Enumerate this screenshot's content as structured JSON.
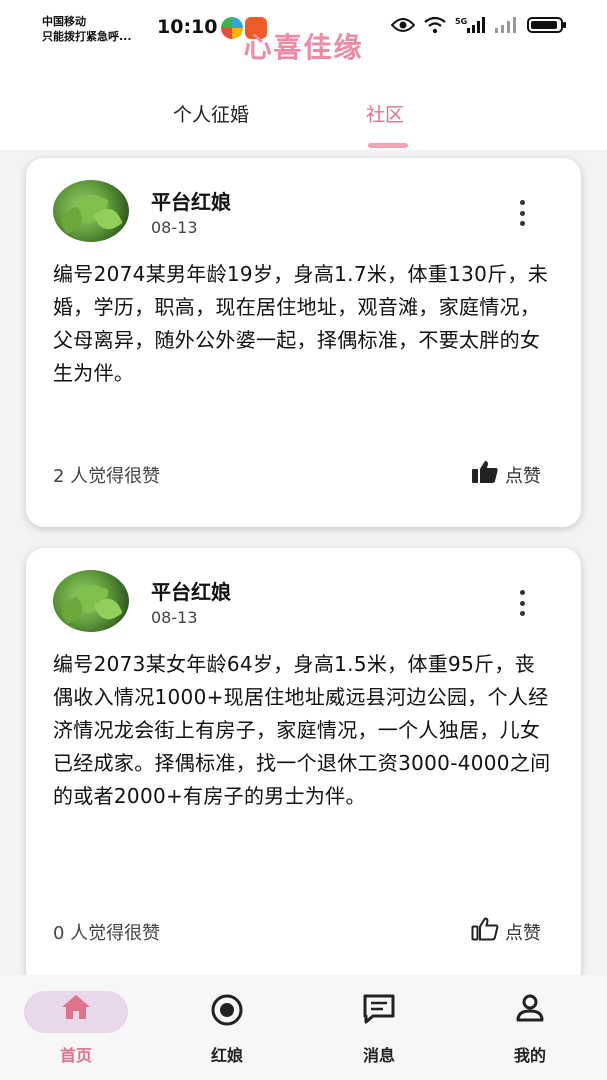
{
  "status_bar": {
    "carrier_line1": "中国移动",
    "carrier_line2": "只能拨打紧急呼...",
    "time": "10:10",
    "network": "5G",
    "wifi": "6"
  },
  "app": {
    "title": "心喜佳缘",
    "accent_color": "#e0728c"
  },
  "tabs": [
    {
      "label": "个人征婚",
      "active": false
    },
    {
      "label": "社区",
      "active": true
    }
  ],
  "posts": [
    {
      "author": "平台红娘",
      "date": "08-13",
      "text": "编号2074某男年龄19岁，身高1.7米，体重130斤，未婚，学历，职高，现在居住地址，观音滩，家庭情况，父母离异，随外公外婆一起，择偶标准，不要太胖的女生为伴。",
      "likes_text": "2 人觉得很赞",
      "like_label": "点赞",
      "liked": true
    },
    {
      "author": "平台红娘",
      "date": "08-13",
      "text": "编号2073某女年龄64岁，身高1.5米，体重95斤，丧偶收入情况1000+现居住地址威远县河边公园，个人经济情况龙会街上有房子，家庭情况，一个人独居，儿女已经成家。择偶标准，找一个退休工资3000-4000之间的或者2000+有房子的男士为伴。",
      "likes_text": "0 人觉得很赞",
      "like_label": "点赞",
      "liked": false
    }
  ],
  "bottom_nav": [
    {
      "label": "首页",
      "icon": "home-icon",
      "active": true
    },
    {
      "label": "红娘",
      "icon": "target-icon",
      "active": false
    },
    {
      "label": "消息",
      "icon": "message-icon",
      "active": false
    },
    {
      "label": "我的",
      "icon": "user-icon",
      "active": false
    }
  ]
}
